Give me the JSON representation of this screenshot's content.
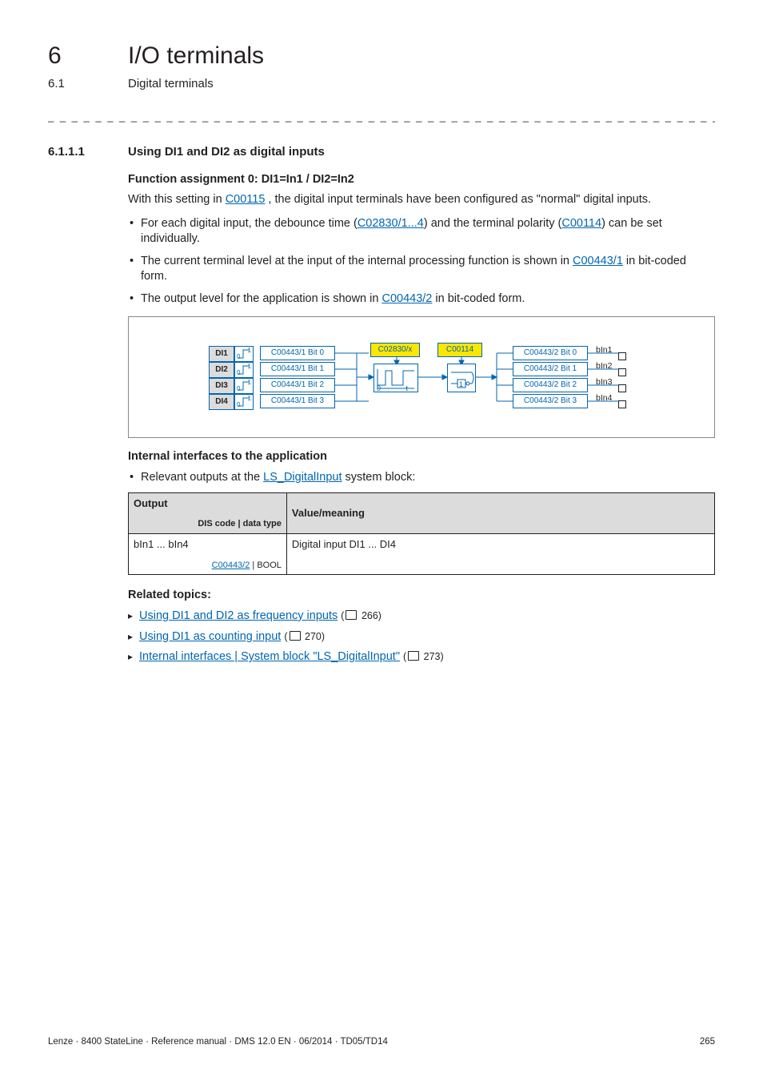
{
  "chapter": {
    "number": "6",
    "title": "I/O terminals"
  },
  "section": {
    "number": "6.1",
    "title": "Digital terminals"
  },
  "dashes": "_ _ _ _ _ _ _ _ _ _ _ _ _ _ _ _ _ _ _ _ _ _ _ _ _ _ _ _ _ _ _ _ _ _ _ _ _ _ _ _ _ _ _ _ _ _ _ _ _ _ _ _ _ _ _ _ _ _ _ _ _ _ _ _",
  "subsection": {
    "number": "6.1.1.1",
    "title": "Using DI1 and DI2 as digital inputs"
  },
  "fa_heading": "Function assignment 0: DI1=In1 / DI2=In2",
  "intro_pre": "With this setting in ",
  "intro_link": "C00115",
  "intro_post": " , the digital input terminals have been configured as \"normal\" digital inputs.",
  "bullets1": {
    "b1_pre": "For each digital input, the debounce time (",
    "b1_link1": "C02830/1...4",
    "b1_mid": ") and the terminal polarity (",
    "b1_link2": "C00114",
    "b1_post": ") can be set individually.",
    "b2_pre": "The current terminal level at the input of the internal processing function is shown in ",
    "b2_link": "C00443/1",
    "b2_post": " in bit-coded form.",
    "b3_pre": "The output level for the application is shown in ",
    "b3_link": "C00443/2",
    "b3_post": " in bit-coded form."
  },
  "diagram": {
    "di": [
      "DI1",
      "DI2",
      "DI3",
      "DI4"
    ],
    "bits_in": [
      "C00443/1 Bit 0",
      "C00443/1 Bit 1",
      "C00443/1 Bit 2",
      "C00443/1 Bit 3"
    ],
    "bits_out": [
      "C00443/2 Bit 0",
      "C00443/2 Bit 1",
      "C00443/2 Bit 2",
      "C00443/2 Bit 3"
    ],
    "c_debounce": "C02830/x",
    "c_polarity": "C00114",
    "out_labels": [
      "bIn1",
      "bIn2",
      "bIn3",
      "bIn4"
    ],
    "deb_zero": "0",
    "deb_t": "t",
    "pol_one": "1"
  },
  "iface_heading": "Internal interfaces to the application",
  "iface_bullet_pre": "Relevant outputs at the ",
  "iface_bullet_link": "LS_DigitalInput",
  "iface_bullet_post": " system block:",
  "table": {
    "h_output": "Output",
    "h_dis": "DIS code | data type",
    "h_value": "Value/meaning",
    "r1_out": "bIn1 ... bIn4",
    "r1_dis_link": "C00443/2",
    "r1_dis_post": " | BOOL",
    "r1_val": "Digital input DI1 ... DI4"
  },
  "related_heading": "Related topics:",
  "related": {
    "r1": "Using DI1 and DI2 as frequency inputs",
    "r1_pg": "266",
    "r2": "Using DI1 as counting input",
    "r2_pg": "270",
    "r3": "Internal interfaces | System block \"LS_DigitalInput\"",
    "r3_pg": "273"
  },
  "footer_left": "Lenze · 8400 StateLine · Reference manual · DMS 12.0 EN · 06/2014 · TD05/TD14",
  "footer_right": "265"
}
